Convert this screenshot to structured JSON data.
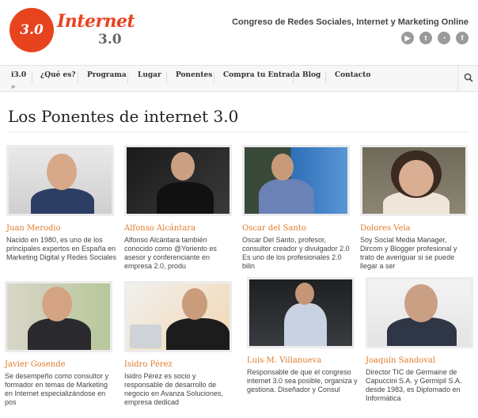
{
  "header": {
    "logo_number": "3.0",
    "logo_word": "Internet",
    "logo_version": "3.0",
    "tagline": "Congreso de Redes Sociales, Internet y Marketing Online",
    "socials": [
      {
        "icon": "youtube-icon",
        "glyph": "▶"
      },
      {
        "icon": "twitter-icon",
        "glyph": "t"
      },
      {
        "icon": "rss-icon",
        "glyph": "◔"
      },
      {
        "icon": "facebook-icon",
        "glyph": "f"
      }
    ]
  },
  "nav": {
    "items": [
      "i3.0",
      "¿Qué es?",
      "Programa",
      "Lugar",
      "Ponentes",
      "Compra tu Entrada",
      "Blog",
      "Contacto"
    ],
    "raquo": "»",
    "search_icon": "search-icon"
  },
  "page": {
    "title": "Los Ponentes de internet 3.0"
  },
  "speakers": [
    {
      "name": "Juan Merodio",
      "bio": "Nacido en 1980, es uno de los principales expertos en España en Marketing Digital y Redes Sociales"
    },
    {
      "name": "Alfonso Alcántara",
      "bio": "Alfonso Alcántara también conocido como @Yoriento es asesor y conferenciante en empresa 2.0, produ"
    },
    {
      "name": "Oscar del Santo",
      "bio": "Oscar Del Santo, profesor, consultor creador y divulgador 2.0 Es uno de los profesionales 2.0 bilin"
    },
    {
      "name": "Dolores Vela",
      "bio": "Soy Social Media Manager, Dircom y Blogger profesional y trato de averiguar si se puede llegar a ser"
    },
    {
      "name": "Javier Gosende",
      "bio": "Se desempeño como consultor y formador en temas de Marketing en Internet especializándose en pos"
    },
    {
      "name": "Isidro Pérez",
      "bio": "Isidro Pérez es socio y responsable de desarrollo de negocio en Avanza Soluciones, empresa dedicad"
    },
    {
      "name": "Luis M. Villanueva",
      "bio": "Responsable de que el congreso internet 3.0 sea posible, organiza y gestiona. Diseñador y Consul"
    },
    {
      "name": "Joaquín Sandoval",
      "bio": "Director TIC de Germaine de Capuccini S.A. y Germipil S.A. desde 1983, es Diplomado en Informática"
    }
  ],
  "colors": {
    "accent": "#e8431f",
    "speaker_name": "#e07b2a"
  }
}
